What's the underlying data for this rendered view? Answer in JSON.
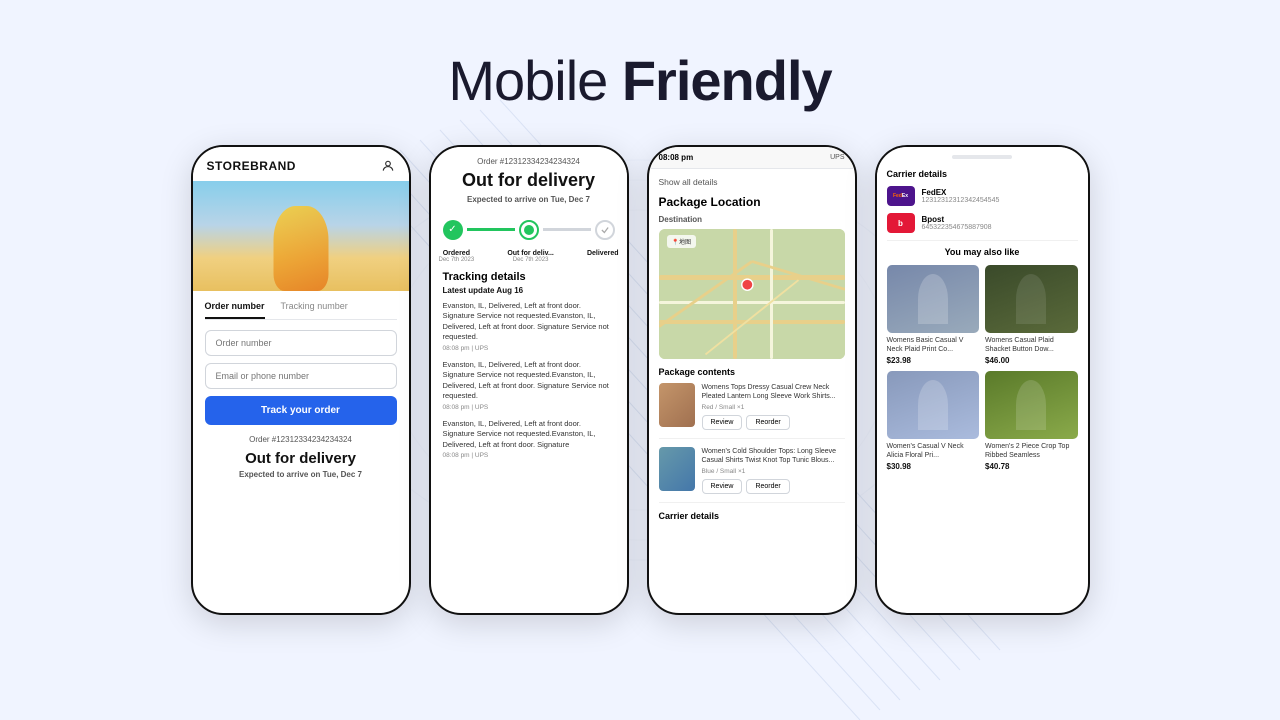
{
  "headline": {
    "part1": "Mobile ",
    "part2": "Friendly"
  },
  "phone1": {
    "brand": "STOREBRAND",
    "tabs": [
      "Order number",
      "Tracking number"
    ],
    "input_order_placeholder": "Order number",
    "input_contact_placeholder": "Email or phone number",
    "track_button": "Track your order",
    "order_number": "Order #12312334234234324",
    "status": "Out for delivery",
    "eta_label": "Expected to arrive on ",
    "eta_date": "Tue, Dec 7"
  },
  "phone2": {
    "order_label": "Order #12312334234234324",
    "status": "Out for delivery",
    "eta_label": "Expected to arrive on ",
    "eta_date": "Tue, Dec 7",
    "progress": {
      "step1_label": "Ordered",
      "step1_date": "Dec 7th 2023",
      "step2_label": "Out for deliv...",
      "step2_date": "Dec 7th 2023",
      "step3_label": "Delivered"
    },
    "tracking_title": "Tracking details",
    "latest_update": "Latest update Aug 16",
    "entries": [
      {
        "desc": "Evanston, IL, Delivered, Left at front door. Signature Service not requested.Evanston, IL, Delivered, Left at front door. Signature Service not requested.",
        "meta": "08:08 pm  |  UPS"
      },
      {
        "desc": "Evanston, IL, Delivered, Left at front door. Signature Service not requested.Evanston, IL, Delivered, Left at front door. Signature Service not requested.",
        "meta": "08:08 pm  |  UPS"
      },
      {
        "desc": "Evanston, IL, Delivered, Left at front door. Signature Service not requested.Evanston, IL, Delivered, Left at front door. Signature",
        "meta": "08:08 pm  |  UPS"
      }
    ]
  },
  "phone3": {
    "time": "08:08 pm",
    "carrier": "UPS",
    "show_all": "Show all details",
    "section_title": "Package Location",
    "destination_label": "Destination",
    "package_contents_title": "Package contents",
    "items": [
      {
        "name": "Womens Tops Dressy Casual Crew Neck Pleated Lantern Long Sleeve Work Shirts...",
        "variant": "Red / Small  ×1",
        "review_btn": "Review",
        "reorder_btn": "Reorder"
      },
      {
        "name": "Women's Cold Shoulder Tops: Long Sleeve Casual Shirts Twist Knot Top Tunic Blous...",
        "variant": "Blue / Small  ×1",
        "review_btn": "Review",
        "reorder_btn": "Reorder"
      }
    ],
    "carrier_details_label": "Carrier details"
  },
  "phone4": {
    "carrier_details_title": "Carrier details",
    "carriers": [
      {
        "name": "FedEX",
        "logo_text": "FedEx",
        "tracking": "12312312312342454545",
        "type": "fedex"
      },
      {
        "name": "Bpost",
        "logo_text": "Bp",
        "tracking": "645322354675887908",
        "type": "bpost"
      }
    ],
    "recommend_title": "You may also like",
    "products": [
      {
        "name": "Womens Basic Casual V Neck Plaid Print Co...",
        "price": "$23.98",
        "img_class": "prod-img-1"
      },
      {
        "name": "Womens Casual Plaid Shacket Button Dow...",
        "price": "$46.00",
        "img_class": "prod-img-2"
      },
      {
        "name": "Women's Casual V Neck Alicia Floral Pri...",
        "price": "$30.98",
        "img_class": "prod-img-3"
      },
      {
        "name": "Women's 2 Piece Crop Top Ribbed Seamless",
        "price": "$40.78",
        "img_class": "prod-img-4"
      }
    ]
  }
}
